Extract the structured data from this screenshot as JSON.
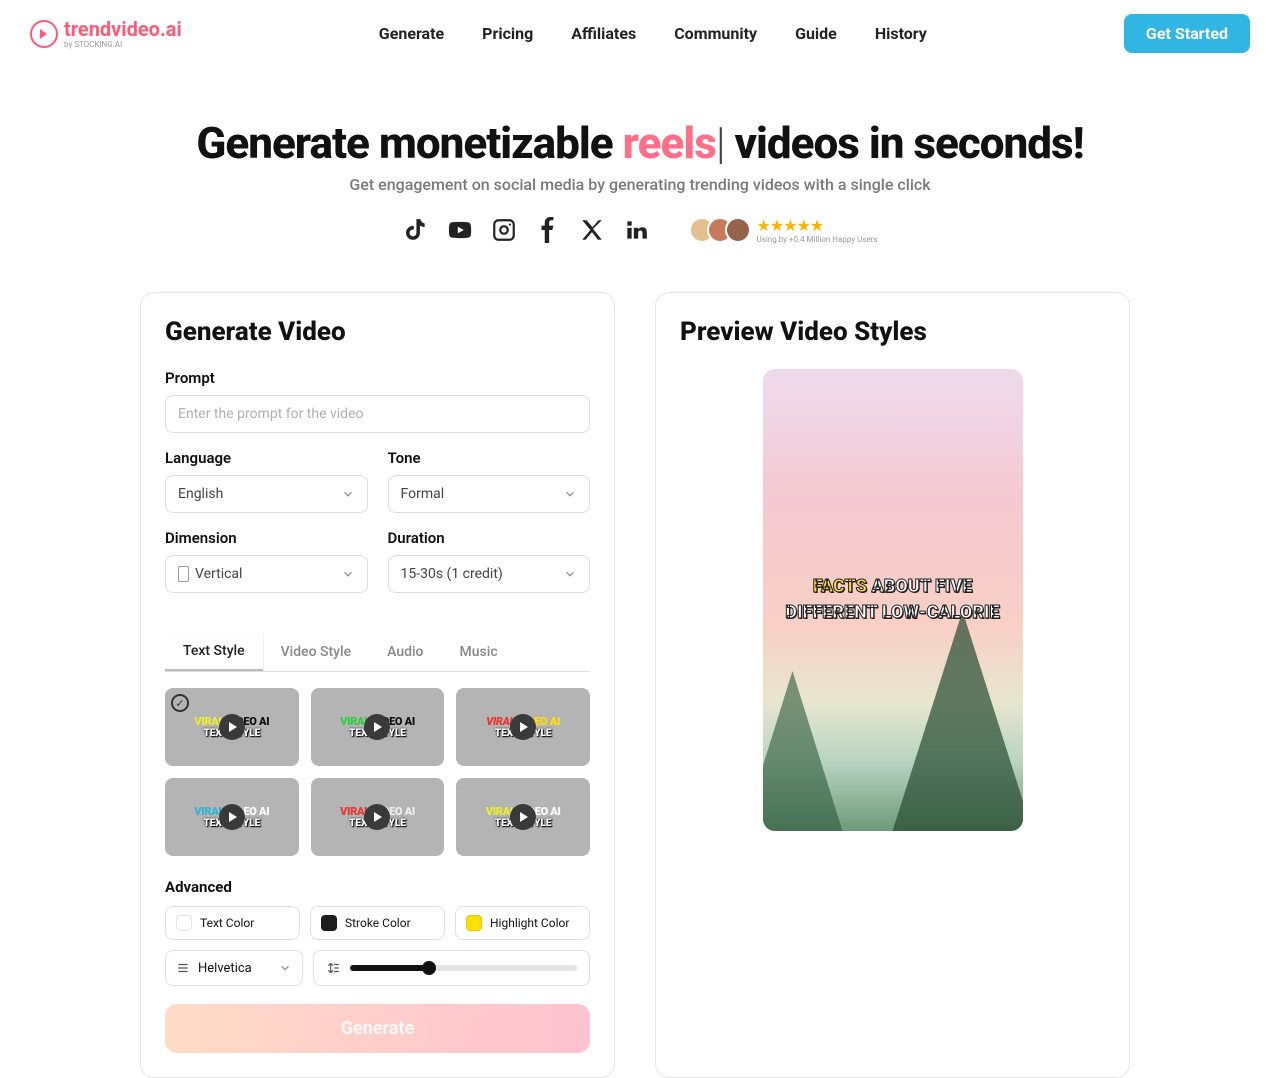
{
  "brand": {
    "name": "trendvideo.ai",
    "sub": "by STOCKING.AI"
  },
  "nav": [
    "Generate",
    "Pricing",
    "Affiliates",
    "Community",
    "Guide",
    "History"
  ],
  "cta": "Get Started",
  "hero": {
    "pre": "Generate monetizable ",
    "accent": "reels",
    "post": " videos in seconds!",
    "subtitle": "Get engagement on social media by generating trending videos with a single click",
    "trust": "Using by +0.4 Million Happy Users"
  },
  "form": {
    "title": "Generate Video",
    "prompt_label": "Prompt",
    "prompt_placeholder": "Enter the prompt for the video",
    "language_label": "Language",
    "language_value": "English",
    "tone_label": "Tone",
    "tone_value": "Formal",
    "dimension_label": "Dimension",
    "dimension_value": "Vertical",
    "duration_label": "Duration",
    "duration_value": "15-30s (1 credit)"
  },
  "subtabs": [
    "Text Style",
    "Video Style",
    "Audio",
    "Music"
  ],
  "style_sample": {
    "line1a": "VIRAL",
    "line1b": " VIDEO AI",
    "line2": "TEXT STYLE"
  },
  "advanced": {
    "title": "Advanced",
    "text_color": {
      "label": "Text Color",
      "value": "#ffffff"
    },
    "stroke_color": {
      "label": "Stroke Color",
      "value": "#1e1e1e"
    },
    "highlight_color": {
      "label": "Highlight Color",
      "value": "#ffe000"
    },
    "font": "Helvetica"
  },
  "generate_label": "Generate",
  "preview": {
    "title": "Preview Video Styles",
    "caption_hl": "FACTS",
    "caption_rest1": " ABOUT FIVE",
    "caption_rest2": "DIFFERENT LOW-CALORIE"
  }
}
